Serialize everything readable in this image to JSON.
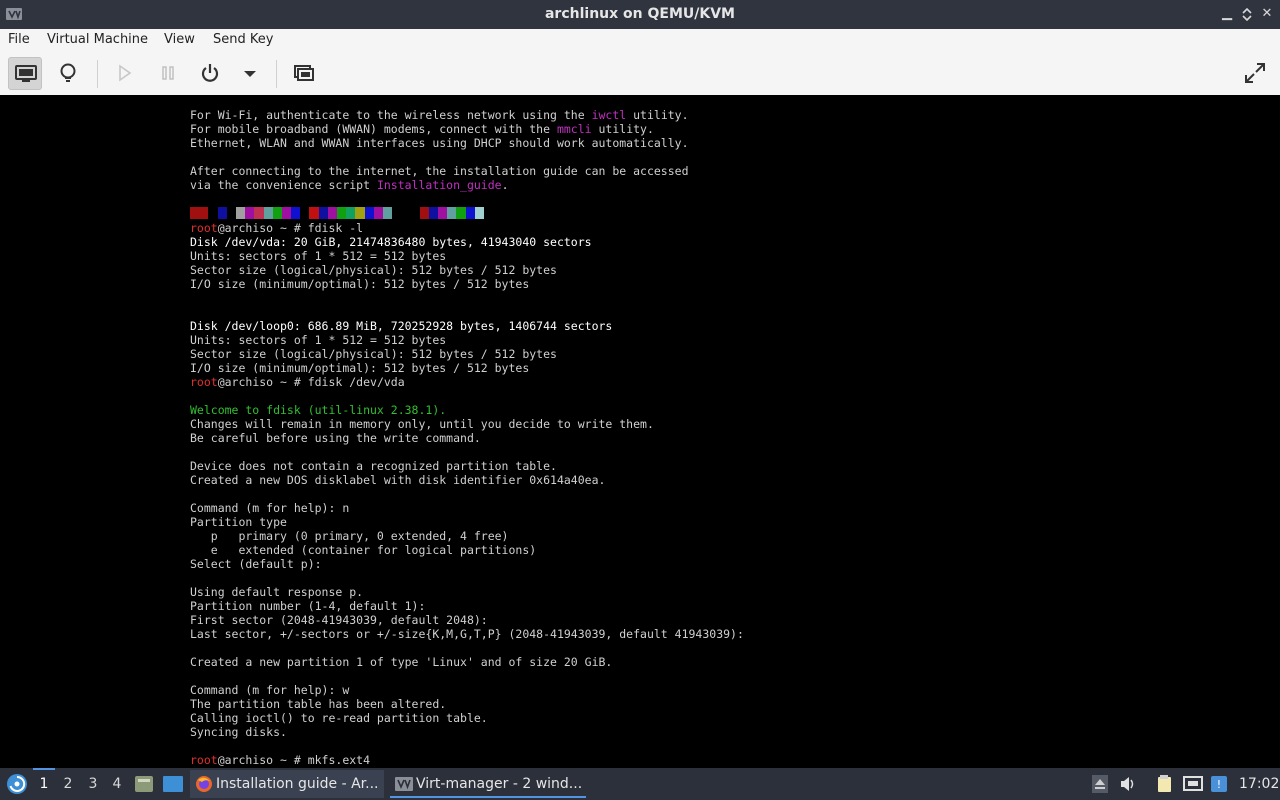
{
  "window": {
    "title": "archlinux on QEMU/KVM",
    "controls": [
      "minimize-icon",
      "restore-icon",
      "close-icon"
    ]
  },
  "menubar": {
    "items": [
      {
        "label": "File"
      },
      {
        "label": "Virtual Machine"
      },
      {
        "label": "View"
      },
      {
        "label": "Send Key"
      }
    ]
  },
  "toolbar": {
    "buttons": [
      {
        "name": "console-view-button",
        "icon": "monitor-icon",
        "active": true
      },
      {
        "name": "details-view-button",
        "icon": "lightbulb-icon",
        "active": false
      },
      {
        "name": "run-button",
        "icon": "play-icon",
        "active": false
      },
      {
        "name": "pause-button",
        "icon": "pause-icon",
        "active": false
      },
      {
        "name": "shutdown-button",
        "icon": "power-icon",
        "active": false
      },
      {
        "name": "shutdown-menu-button",
        "icon": "chevron-down-icon",
        "active": false
      },
      {
        "name": "snapshots-button",
        "icon": "snapshot-icon",
        "active": false
      },
      {
        "name": "fullscreen-button",
        "icon": "fullscreen-icon",
        "active": false
      }
    ]
  },
  "console": {
    "lines": [
      {
        "parts": [
          {
            "t": "For Wi-Fi, authenticate to the wireless network using the "
          },
          {
            "t": "iwctl",
            "c": "mag"
          },
          {
            "t": " utility."
          }
        ]
      },
      {
        "parts": [
          {
            "t": "For mobile broadband (WWAN) modems, connect with the "
          },
          {
            "t": "mmcli",
            "c": "mag"
          },
          {
            "t": " utility."
          }
        ]
      },
      {
        "parts": [
          {
            "t": "Ethernet, WLAN and WWAN interfaces using DHCP should work automatically."
          }
        ]
      },
      {
        "parts": [
          {
            "t": ""
          }
        ]
      },
      {
        "parts": [
          {
            "t": "After connecting to the internet, the installation guide can be accessed"
          }
        ]
      },
      {
        "parts": [
          {
            "t": "via the convenience script "
          },
          {
            "t": "Installation_guide",
            "c": "mag"
          },
          {
            "t": "."
          }
        ]
      },
      {
        "parts": [
          {
            "t": ""
          }
        ]
      },
      {
        "colorbar": true
      },
      {
        "parts": [
          {
            "t": "root",
            "c": "red"
          },
          {
            "t": "@archiso ~ # fdisk -l"
          }
        ]
      },
      {
        "parts": [
          {
            "t": "Disk /dev/vda: 20 GiB, 21474836480 bytes, 41943040 sectors",
            "c": "white"
          }
        ]
      },
      {
        "parts": [
          {
            "t": "Units: sectors of 1 * 512 = 512 bytes"
          }
        ]
      },
      {
        "parts": [
          {
            "t": "Sector size (logical/physical): 512 bytes / 512 bytes"
          }
        ]
      },
      {
        "parts": [
          {
            "t": "I/O size (minimum/optimal): 512 bytes / 512 bytes"
          }
        ]
      },
      {
        "parts": [
          {
            "t": ""
          }
        ]
      },
      {
        "parts": [
          {
            "t": ""
          }
        ]
      },
      {
        "parts": [
          {
            "t": "Disk /dev/loop0: 686.89 MiB, 720252928 bytes, 1406744 sectors",
            "c": "white"
          }
        ]
      },
      {
        "parts": [
          {
            "t": "Units: sectors of 1 * 512 = 512 bytes"
          }
        ]
      },
      {
        "parts": [
          {
            "t": "Sector size (logical/physical): 512 bytes / 512 bytes"
          }
        ]
      },
      {
        "parts": [
          {
            "t": "I/O size (minimum/optimal): 512 bytes / 512 bytes"
          }
        ]
      },
      {
        "parts": [
          {
            "t": "root",
            "c": "red"
          },
          {
            "t": "@archiso ~ # fdisk /dev/vda"
          }
        ]
      },
      {
        "parts": [
          {
            "t": ""
          }
        ]
      },
      {
        "parts": [
          {
            "t": "Welcome to fdisk (util-linux 2.38.1).",
            "c": "green"
          }
        ]
      },
      {
        "parts": [
          {
            "t": "Changes will remain in memory only, until you decide to write them."
          }
        ]
      },
      {
        "parts": [
          {
            "t": "Be careful before using the write command."
          }
        ]
      },
      {
        "parts": [
          {
            "t": ""
          }
        ]
      },
      {
        "parts": [
          {
            "t": "Device does not contain a recognized partition table."
          }
        ]
      },
      {
        "parts": [
          {
            "t": "Created a new DOS disklabel with disk identifier 0x614a40ea."
          }
        ]
      },
      {
        "parts": [
          {
            "t": ""
          }
        ]
      },
      {
        "parts": [
          {
            "t": "Command (m for help): n"
          }
        ]
      },
      {
        "parts": [
          {
            "t": "Partition type"
          }
        ]
      },
      {
        "parts": [
          {
            "t": "   p   primary (0 primary, 0 extended, 4 free)"
          }
        ]
      },
      {
        "parts": [
          {
            "t": "   e   extended (container for logical partitions)"
          }
        ]
      },
      {
        "parts": [
          {
            "t": "Select (default p):"
          }
        ]
      },
      {
        "parts": [
          {
            "t": ""
          }
        ]
      },
      {
        "parts": [
          {
            "t": "Using default response p."
          }
        ]
      },
      {
        "parts": [
          {
            "t": "Partition number (1-4, default 1):"
          }
        ]
      },
      {
        "parts": [
          {
            "t": "First sector (2048-41943039, default 2048):"
          }
        ]
      },
      {
        "parts": [
          {
            "t": "Last sector, +/-sectors or +/-size{K,M,G,T,P} (2048-41943039, default 41943039):"
          }
        ]
      },
      {
        "parts": [
          {
            "t": ""
          }
        ]
      },
      {
        "parts": [
          {
            "t": "Created a new partition 1 of type 'Linux' and of size 20 GiB."
          }
        ]
      },
      {
        "parts": [
          {
            "t": ""
          }
        ]
      },
      {
        "parts": [
          {
            "t": "Command (m for help): w"
          }
        ]
      },
      {
        "parts": [
          {
            "t": "The partition table has been altered."
          }
        ]
      },
      {
        "parts": [
          {
            "t": "Calling ioctl() to re-read partition table."
          }
        ]
      },
      {
        "parts": [
          {
            "t": "Syncing disks."
          }
        ]
      },
      {
        "parts": [
          {
            "t": ""
          }
        ]
      },
      {
        "parts": [
          {
            "t": "root",
            "c": "red"
          },
          {
            "t": "@archiso ~ # mkfs.ext4"
          }
        ]
      }
    ],
    "colors": {
      "magenta": "#c030c0",
      "red": "#e03030",
      "green": "#30c030"
    },
    "colorbar": [
      "#a01010",
      "#a01010",
      "#000000",
      "#1010a0",
      "#000000",
      "#a0a0a0",
      "#a010a0",
      "#c03050",
      "#60a0a0",
      "#10a010",
      "#a010a0",
      "#1010d0",
      "#000000",
      "#c01010",
      "#1010a0",
      "#a010a0",
      "#10a010",
      "#10a060",
      "#a0a010",
      "#1010d0",
      "#a010a0",
      "#60a0a0",
      "#000000",
      "#000000",
      "#000000",
      "#a01010",
      "#1010a0",
      "#a010a0",
      "#60a0a0",
      "#10a010",
      "#1010d0",
      "#a0d0d0"
    ]
  },
  "taskbar": {
    "workspaces": [
      "1",
      "2",
      "3",
      "4"
    ],
    "active_workspace": "1",
    "tasks": [
      {
        "label": "Installation guide - Ar...",
        "icon": "firefox-icon"
      },
      {
        "label": "Virt-manager - 2 wind...",
        "icon": "virt-manager-icon"
      }
    ],
    "clock": "17:02"
  }
}
